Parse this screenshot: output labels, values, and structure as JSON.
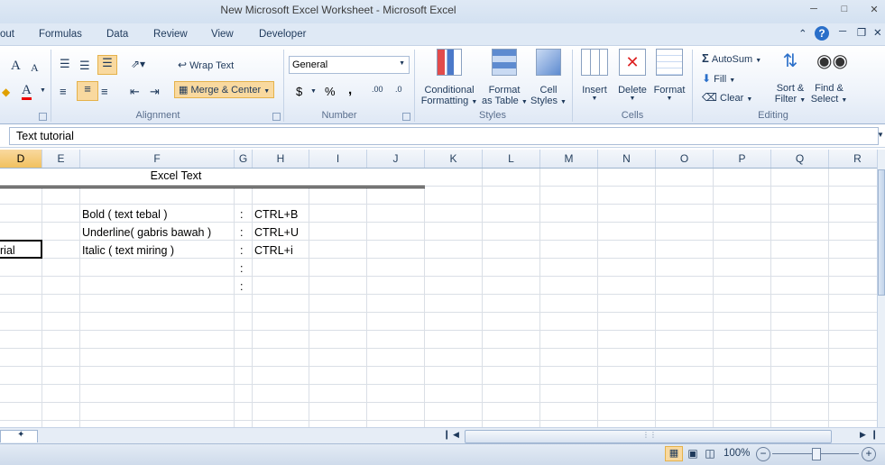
{
  "window": {
    "title": "New Microsoft Excel Worksheet  -  Microsoft Excel"
  },
  "tabs": [
    "out",
    "Formulas",
    "Data",
    "Review",
    "View",
    "Developer"
  ],
  "ribbon": {
    "font": {
      "grow": "A",
      "shrink": "A",
      "font_color": "A"
    },
    "alignment": {
      "wrap_text": "Wrap Text",
      "merge_center": "Merge & Center",
      "label": "Alignment"
    },
    "number": {
      "format": "General",
      "currency": "$",
      "percent": "%",
      "comma": ",",
      "inc_decimal": ".00",
      "dec_decimal": ".0",
      "label": "Number"
    },
    "styles": {
      "conditional": "Conditional",
      "conditional2": "Formatting",
      "format_table": "Format",
      "format_table2": "as Table",
      "cell_styles": "Cell",
      "cell_styles2": "Styles",
      "label": "Styles"
    },
    "cells": {
      "insert": "Insert",
      "delete": "Delete",
      "format": "Format",
      "label": "Cells"
    },
    "editing": {
      "autosum": "AutoSum",
      "fill": "Fill",
      "clear": "Clear",
      "sort": "Sort &",
      "sort2": "Filter",
      "find": "Find &",
      "find2": "Select",
      "label": "Editing"
    }
  },
  "formula_bar": {
    "content": "Text tutorial"
  },
  "columns": [
    "D",
    "E",
    "F",
    "G",
    "H",
    "I",
    "J",
    "K",
    "L",
    "M",
    "N",
    "O",
    "P",
    "Q",
    "R"
  ],
  "cells": {
    "header": "Excel Text",
    "row1": {
      "label": "Bold ( text tebal )",
      "colon": ":",
      "value": "CTRL+B"
    },
    "row2": {
      "label": "Underline( gabris bawah )",
      "colon": ":",
      "value": "CTRL+U"
    },
    "row3": {
      "prefix": "rial",
      "label": "Italic ( text miring )",
      "colon": ":",
      "value": "CTRL+i"
    },
    "row4": {
      "colon": ":"
    },
    "row5": {
      "colon": ":"
    }
  },
  "status": {
    "zoom": "100%"
  },
  "colors": {
    "accent": "#f1c15f",
    "ribbon": "#dfe9f5",
    "grid": "#dadfe6"
  }
}
